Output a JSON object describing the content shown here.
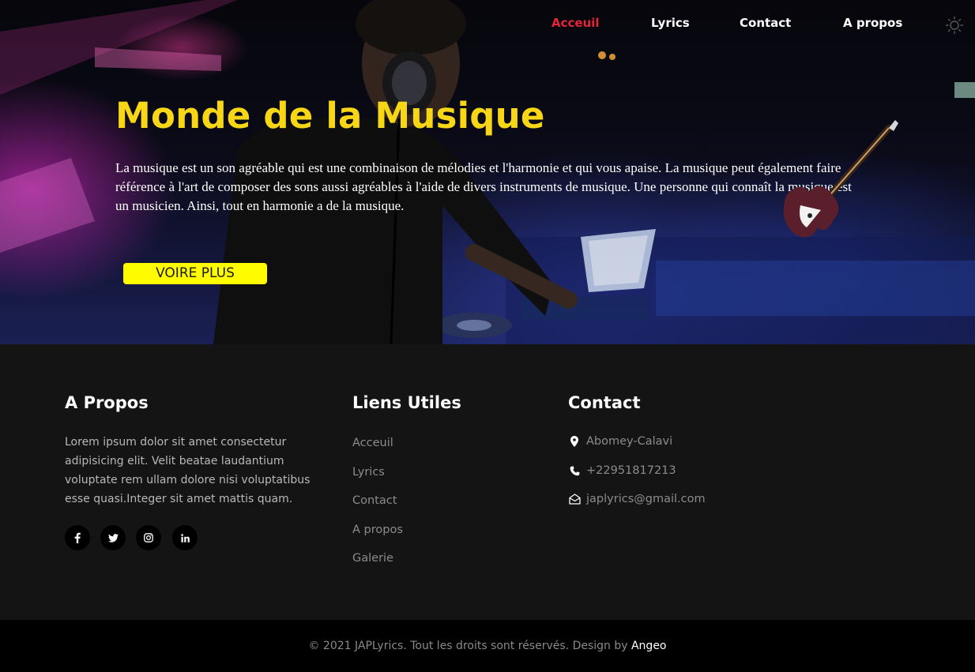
{
  "nav": {
    "items": [
      {
        "label": "Acceuil",
        "active": true
      },
      {
        "label": "Lyrics",
        "active": false
      },
      {
        "label": "Contact",
        "active": false
      },
      {
        "label": "A propos",
        "active": false
      }
    ],
    "theme_icon": "sun-icon"
  },
  "hero": {
    "title": "Monde de la Musique",
    "text": "La musique est un son agréable qui est une combinaison de mélodies et l'harmonie et qui vous apaise. La musique peut également faire référence à l'art de composer des sons aussi agréables à l'aide de divers instruments de musique. Une personne qui connaît la musique est un musicien. Ainsi, tout en harmonie a de la musique.",
    "button_label": "VOIRE PLUS"
  },
  "footer": {
    "about": {
      "title": "A Propos",
      "text": "Lorem ipsum dolor sit amet consectetur adipisicing elit. Velit beatae laudantium voluptate rem ullam dolore nisi voluptatibus esse quasi.Integer sit amet mattis quam.",
      "social": [
        "facebook-icon",
        "twitter-icon",
        "instagram-icon",
        "linkedin-icon"
      ]
    },
    "links": {
      "title": "Liens Utiles",
      "items": [
        "Acceuil",
        "Lyrics",
        "Contact",
        "A propos",
        "Galerie"
      ]
    },
    "contact": {
      "title": "Contact",
      "address": "Abomey-Calavi",
      "phone": "+22951817213",
      "email": "japlyrics@gmail.com"
    }
  },
  "copyright": {
    "text": "© 2021 JAPLyrics. Tout les droits sont réservés. Design by ",
    "author": "Angeo"
  },
  "colors": {
    "accent_yellow": "#f7d616",
    "active_red": "#e6243a",
    "button_yellow": "#fffc00",
    "footer_bg": "#141414"
  }
}
